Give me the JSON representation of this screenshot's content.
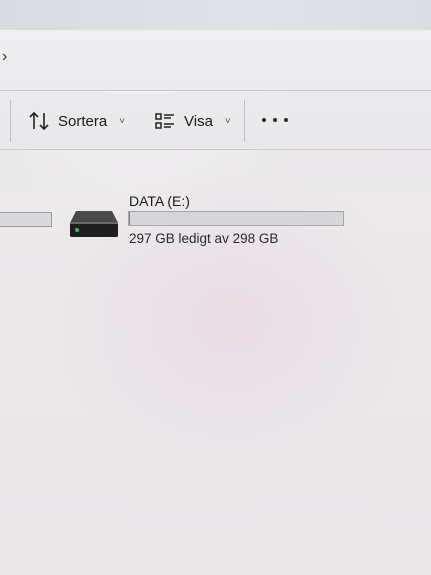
{
  "toolbar": {
    "sort_label": "Sortera",
    "view_label": "Visa",
    "sort_icon": "sort-arrows-icon",
    "view_icon": "view-list-icon",
    "more_icon": "more-dots-icon"
  },
  "drive": {
    "name": "DATA (E:)",
    "space_text": "297 GB ledigt av 298 GB",
    "used_fraction": 0.003,
    "icon": "hard-drive-icon"
  },
  "colors": {
    "accent_fill": "#26a0da"
  }
}
